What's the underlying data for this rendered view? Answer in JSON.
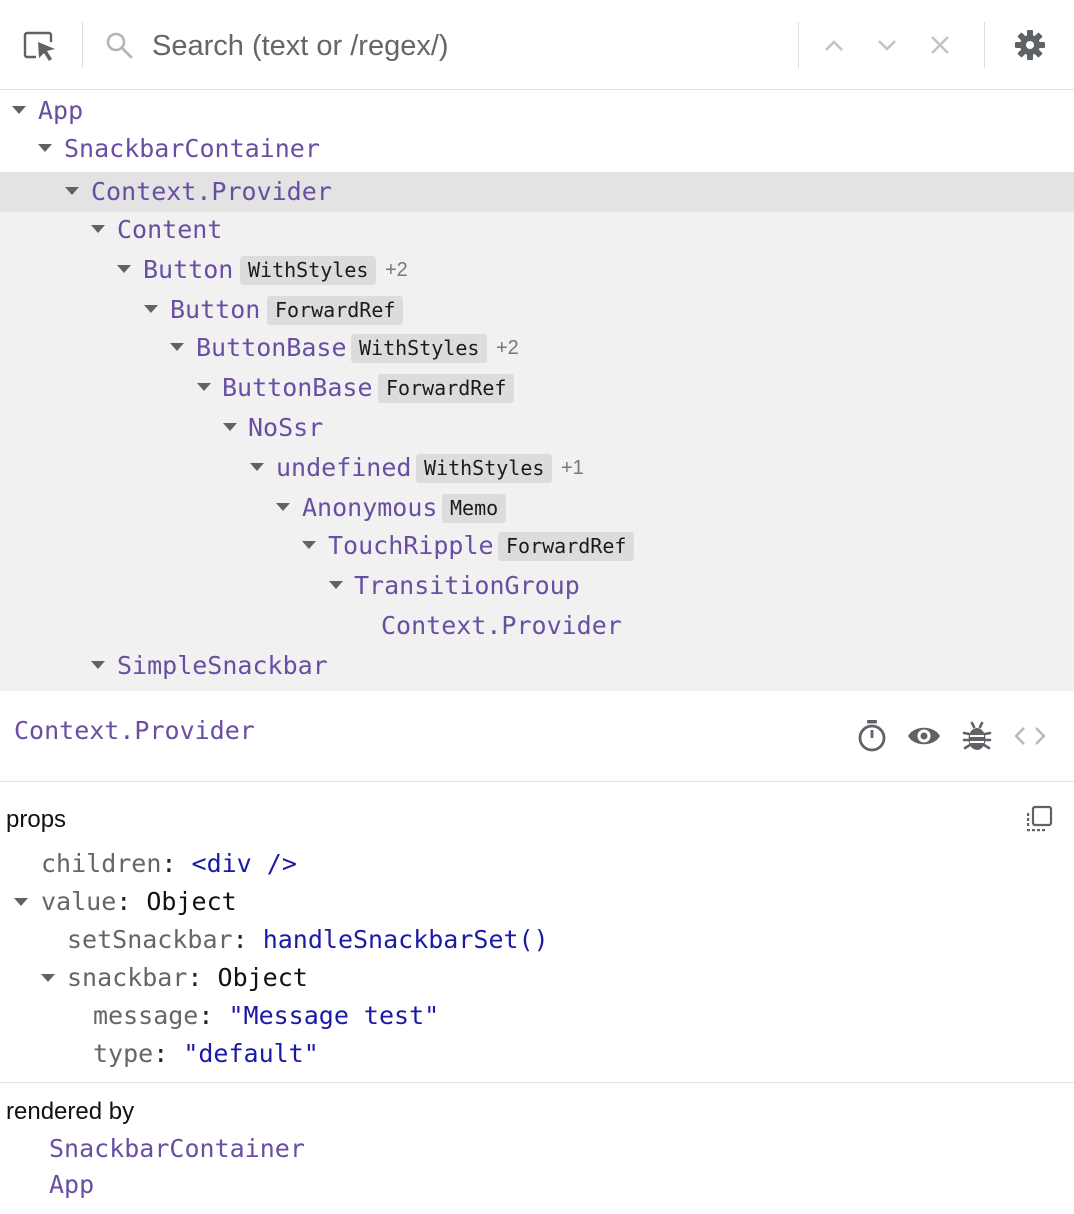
{
  "search": {
    "placeholder": "Search (text or /regex/)"
  },
  "icons": {
    "inspect": "inspect-element-icon",
    "search": "search-icon",
    "prev": "chevron-up-icon",
    "next": "chevron-down-icon",
    "clear": "close-icon",
    "settings": "gear-icon",
    "profiler": "stopwatch-icon",
    "inspect_dom": "eye-icon",
    "log": "bug-icon",
    "source": "code-brackets-icon",
    "copy": "copy-icon"
  },
  "tree": {
    "rows": [
      {
        "name": "App"
      },
      {
        "name": "SnackbarContainer"
      },
      {
        "name": "Context.Provider"
      },
      {
        "name": "Content"
      },
      {
        "name": "Button",
        "badge": "WithStyles",
        "extra": "+2"
      },
      {
        "name": "Button",
        "badge": "ForwardRef"
      },
      {
        "name": "ButtonBase",
        "badge": "WithStyles",
        "extra": "+2"
      },
      {
        "name": "ButtonBase",
        "badge": "ForwardRef"
      },
      {
        "name": "NoSsr"
      },
      {
        "name": "undefined",
        "badge": "WithStyles",
        "extra": "+1"
      },
      {
        "name": "Anonymous",
        "badge": "Memo"
      },
      {
        "name": "TouchRipple",
        "badge": "ForwardRef"
      },
      {
        "name": "TransitionGroup"
      },
      {
        "name": "Context.Provider"
      },
      {
        "name": "SimpleSnackbar"
      }
    ]
  },
  "selected": {
    "name": "Context.Provider"
  },
  "props": {
    "title": "props",
    "children_key": "children",
    "children_val": "<div />",
    "value_key": "value",
    "value_val": "Object",
    "setSnackbar_key": "setSnackbar",
    "setSnackbar_val": "handleSnackbarSet()",
    "snackbar_key": "snackbar",
    "snackbar_val": "Object",
    "message_key": "message",
    "message_val": "\"Message test\"",
    "type_key": "type",
    "type_val": "\"default\""
  },
  "rendered_by": {
    "title": "rendered by",
    "owners": [
      "SnackbarContainer",
      "App"
    ]
  },
  "colors": {
    "component": "#6a4ea3",
    "selected_row": "#e3e3e3",
    "tree_bg": "#f1f1f1",
    "value_blue": "#1a1aa6"
  }
}
